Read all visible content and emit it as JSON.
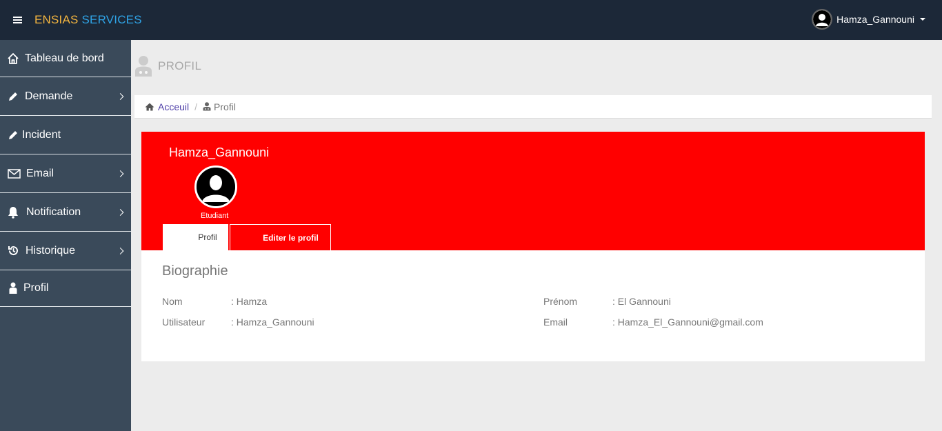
{
  "brand": {
    "part1": "ENSIAS",
    "part2": "SERVICES"
  },
  "user": {
    "name": "Hamza_Gannouni"
  },
  "sidebar": {
    "items": [
      {
        "label": "Tableau de bord",
        "icon": "home-icon",
        "chevron": false
      },
      {
        "label": "Demande",
        "icon": "pencil-icon",
        "chevron": true
      },
      {
        "label": "Incident",
        "icon": "pencil-icon",
        "chevron": false
      },
      {
        "label": "Email",
        "icon": "envelope-icon",
        "chevron": true
      },
      {
        "label": "Notification",
        "icon": "bell-icon",
        "chevron": true
      },
      {
        "label": "Historique",
        "icon": "history-icon",
        "chevron": true
      },
      {
        "label": "Profil",
        "icon": "user-icon",
        "chevron": false
      }
    ]
  },
  "page": {
    "title": "PROFIL"
  },
  "breadcrumb": {
    "home": "Acceuil",
    "separator": "/",
    "current": "Profil"
  },
  "profile": {
    "name": "Hamza_Gannouni",
    "role": "Etudiant",
    "tabs": {
      "profil": "Profil",
      "edit": "Editer le profil"
    },
    "bio_title": "Biographie",
    "fields": {
      "nom_label": "Nom",
      "nom_value": ": Hamza",
      "prenom_label": "Prénom",
      "prenom_value": ": El Gannouni",
      "user_label": "Utilisateur",
      "user_value": ": Hamza_Gannouni",
      "email_label": "Email",
      "email_value": ": Hamza_El_Gannouni@gmail.com"
    }
  },
  "colors": {
    "topbar": "#1c2838",
    "sidebar": "#3a4a5a",
    "banner": "#ff0000",
    "brand_orange": "#f5b63f",
    "brand_blue": "#2fa4e7"
  }
}
